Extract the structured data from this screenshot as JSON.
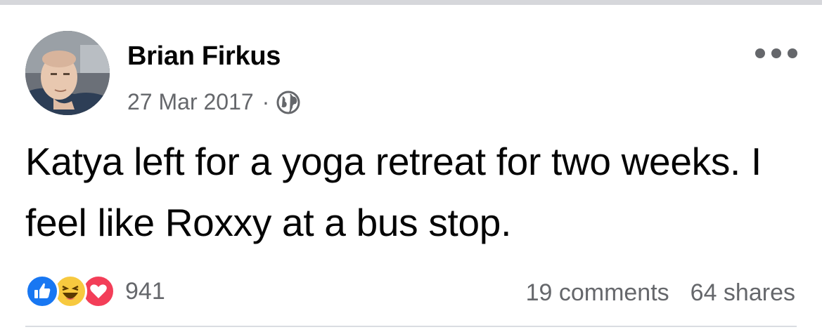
{
  "post": {
    "author": "Brian Firkus",
    "date": "27 Mar 2017",
    "separator": "·",
    "privacy_icon": "globe-icon",
    "text": "Katya left for a yoga retreat for two weeks. I feel like Roxxy at a bus stop.",
    "reactions": {
      "icons": [
        "like-icon",
        "haha-icon",
        "love-icon"
      ],
      "count": "941"
    },
    "comments": "19 comments",
    "shares": "64 shares"
  },
  "colors": {
    "like": "#1877f2",
    "haha": "#f7c93f",
    "love": "#f33e58",
    "secondary_text": "#65676b"
  }
}
